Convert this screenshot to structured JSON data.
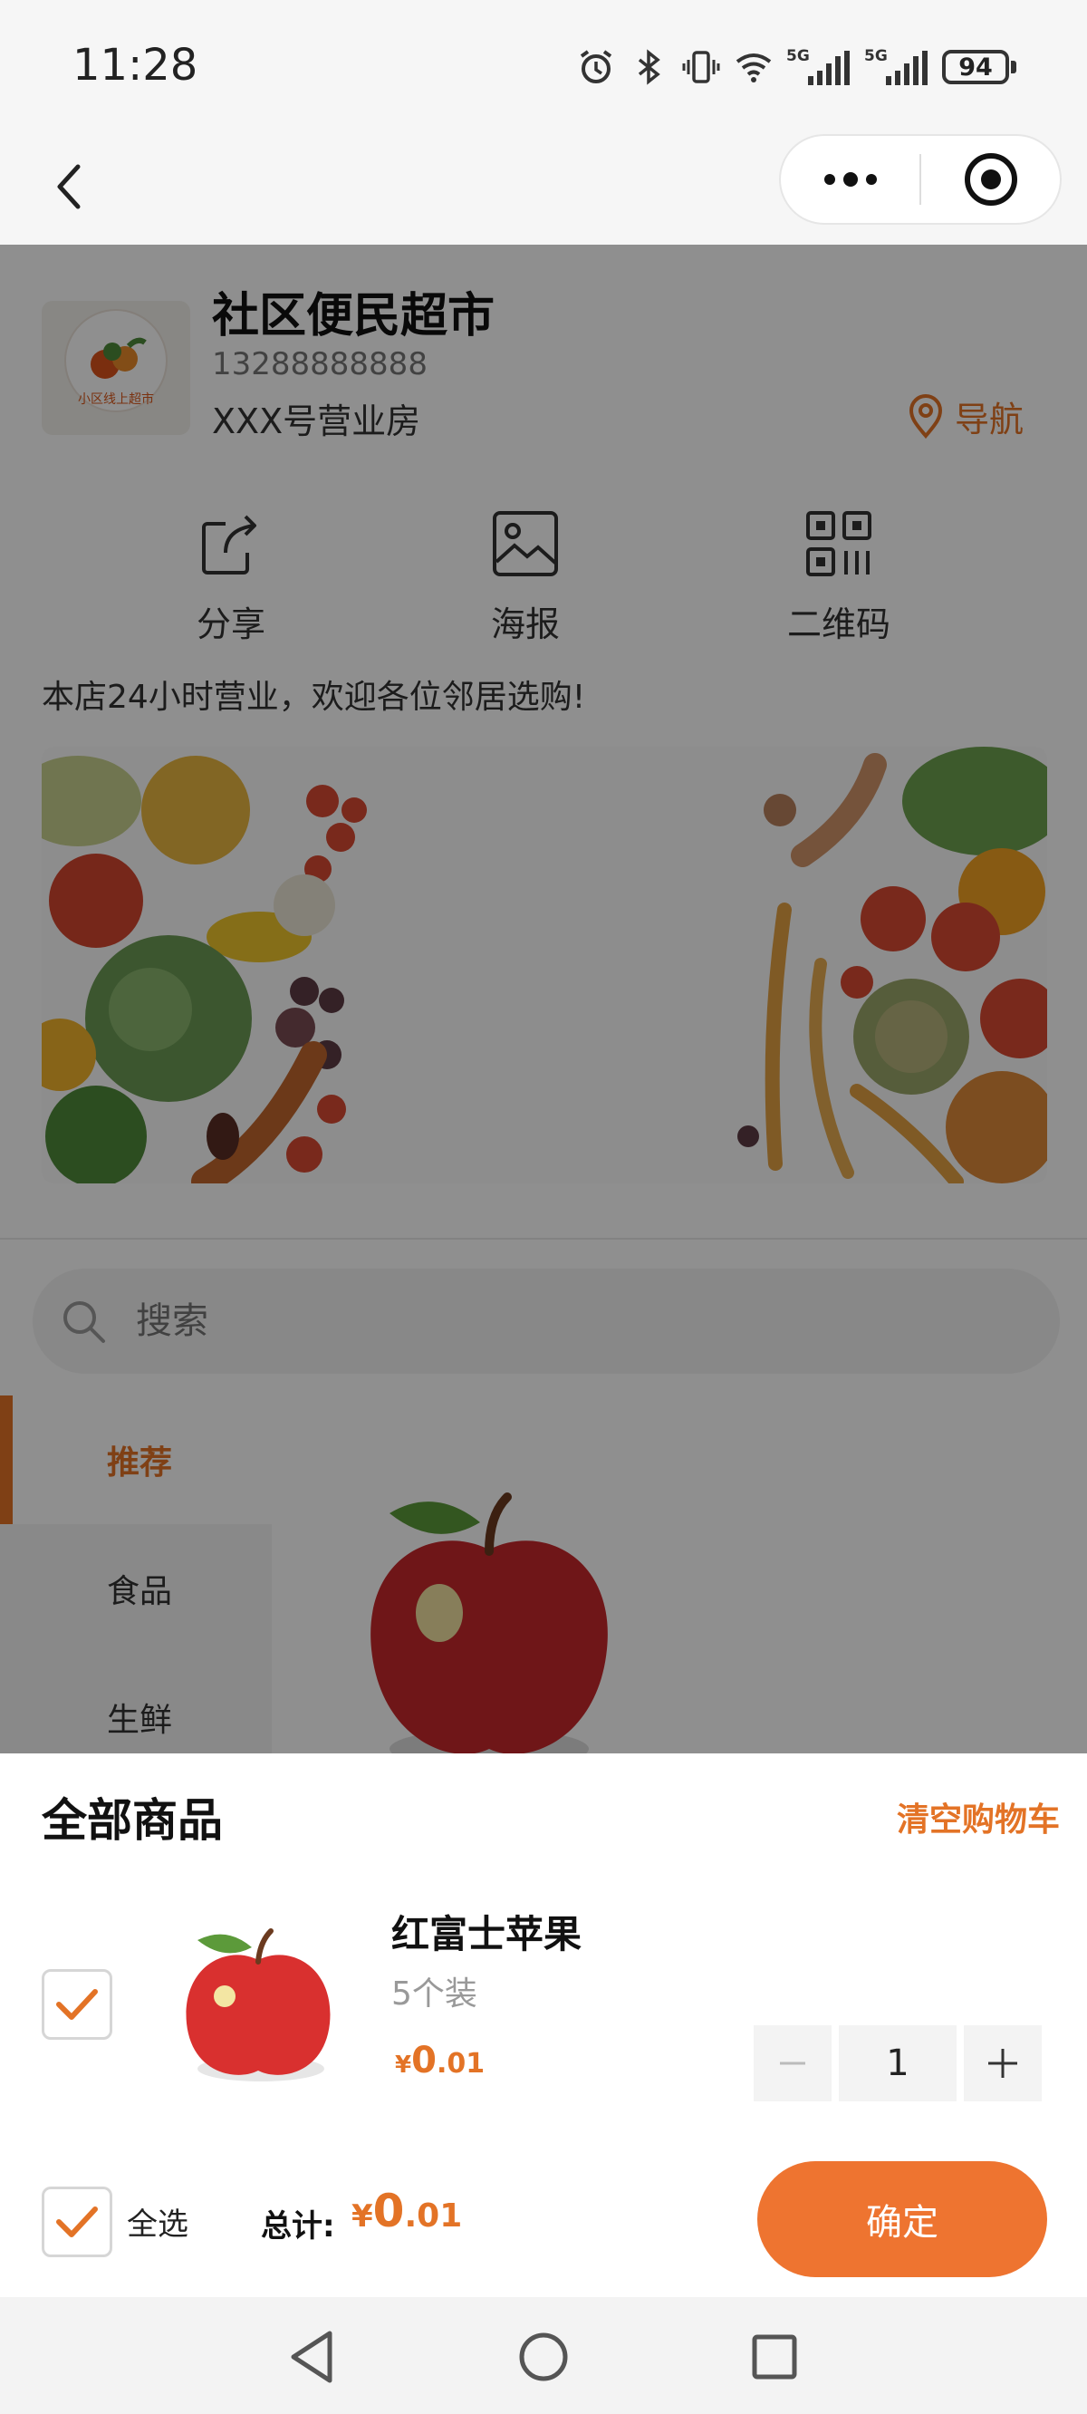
{
  "status_bar": {
    "time": "11:28",
    "network_1": "5G",
    "network_2": "5G",
    "battery": "94",
    "icons": [
      "alarm-icon",
      "bluetooth-icon",
      "vibrate-icon",
      "wifi-icon",
      "signal-icon",
      "signal-icon",
      "battery-icon"
    ]
  },
  "header": {
    "back_icon": "chevron-left-icon",
    "more_icon": "more-dots-icon",
    "target_icon": "target-icon"
  },
  "store": {
    "logo_text": "小区线上超市",
    "name": "社区便民超市",
    "phone": "13288888888",
    "address": "XXX号营业房",
    "navigate_label": "导航",
    "notice": "本店24小时营业，欢迎各位邻居选购!"
  },
  "tools": [
    {
      "label": "分享",
      "icon": "share-icon"
    },
    {
      "label": "海报",
      "icon": "image-icon"
    },
    {
      "label": "二维码",
      "icon": "qrcode-icon"
    }
  ],
  "search": {
    "placeholder": "搜索"
  },
  "categories": [
    {
      "label": "推荐",
      "active": true
    },
    {
      "label": "食品",
      "active": false
    },
    {
      "label": "生鲜",
      "active": false
    }
  ],
  "cart": {
    "title": "全部商品",
    "clear_label": "清空购物车",
    "items": [
      {
        "name": "红富士苹果",
        "spec": "5个装",
        "currency": "¥",
        "price_int": "0",
        "price_dec": ".01",
        "quantity": "1",
        "checked": true
      }
    ],
    "select_all_label": "全选",
    "total_label": "总计:",
    "total_currency": "¥",
    "total_int": "0",
    "total_dec": ".01",
    "confirm_label": "确定"
  },
  "colors": {
    "accent": "#E37326",
    "button": "#EE7430",
    "overlay": "rgba(0,0,0,0.44)"
  }
}
